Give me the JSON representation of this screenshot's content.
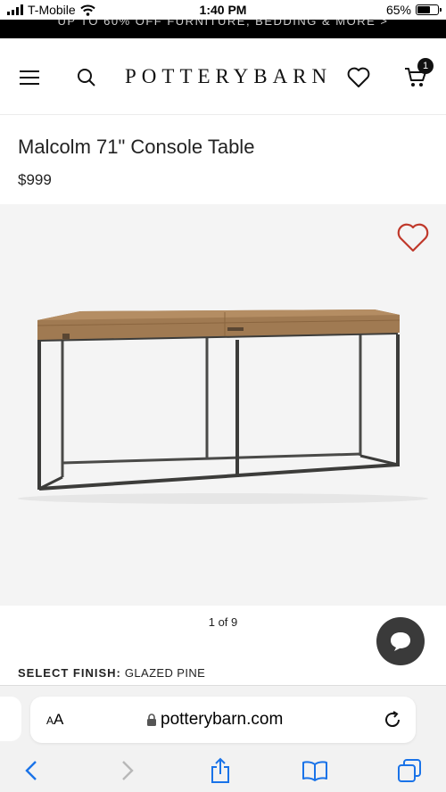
{
  "status_bar": {
    "carrier": "T-Mobile",
    "time": "1:40 PM",
    "battery_percent": "65%",
    "battery_level": 0.65
  },
  "promo": {
    "text": "UP TO 60% OFF FURNITURE, BEDDING & MORE >"
  },
  "header": {
    "logo": "POTTERYBARN",
    "cart_count": "1",
    "icons": [
      "menu-icon",
      "search-icon",
      "heart-icon",
      "cart-icon"
    ]
  },
  "product": {
    "title": "Malcolm 71\" Console Table",
    "price": "$999"
  },
  "gallery": {
    "counter": "1 of 9"
  },
  "finish": {
    "label": "SELECT FINISH:",
    "value": "GLAZED PINE"
  },
  "browser": {
    "text_size_label_small": "A",
    "text_size_label_large": "A",
    "url": "potterybarn.com"
  },
  "colors": {
    "accent": "#c0392b",
    "black": "#000000",
    "chat": "#3a3a3a"
  }
}
